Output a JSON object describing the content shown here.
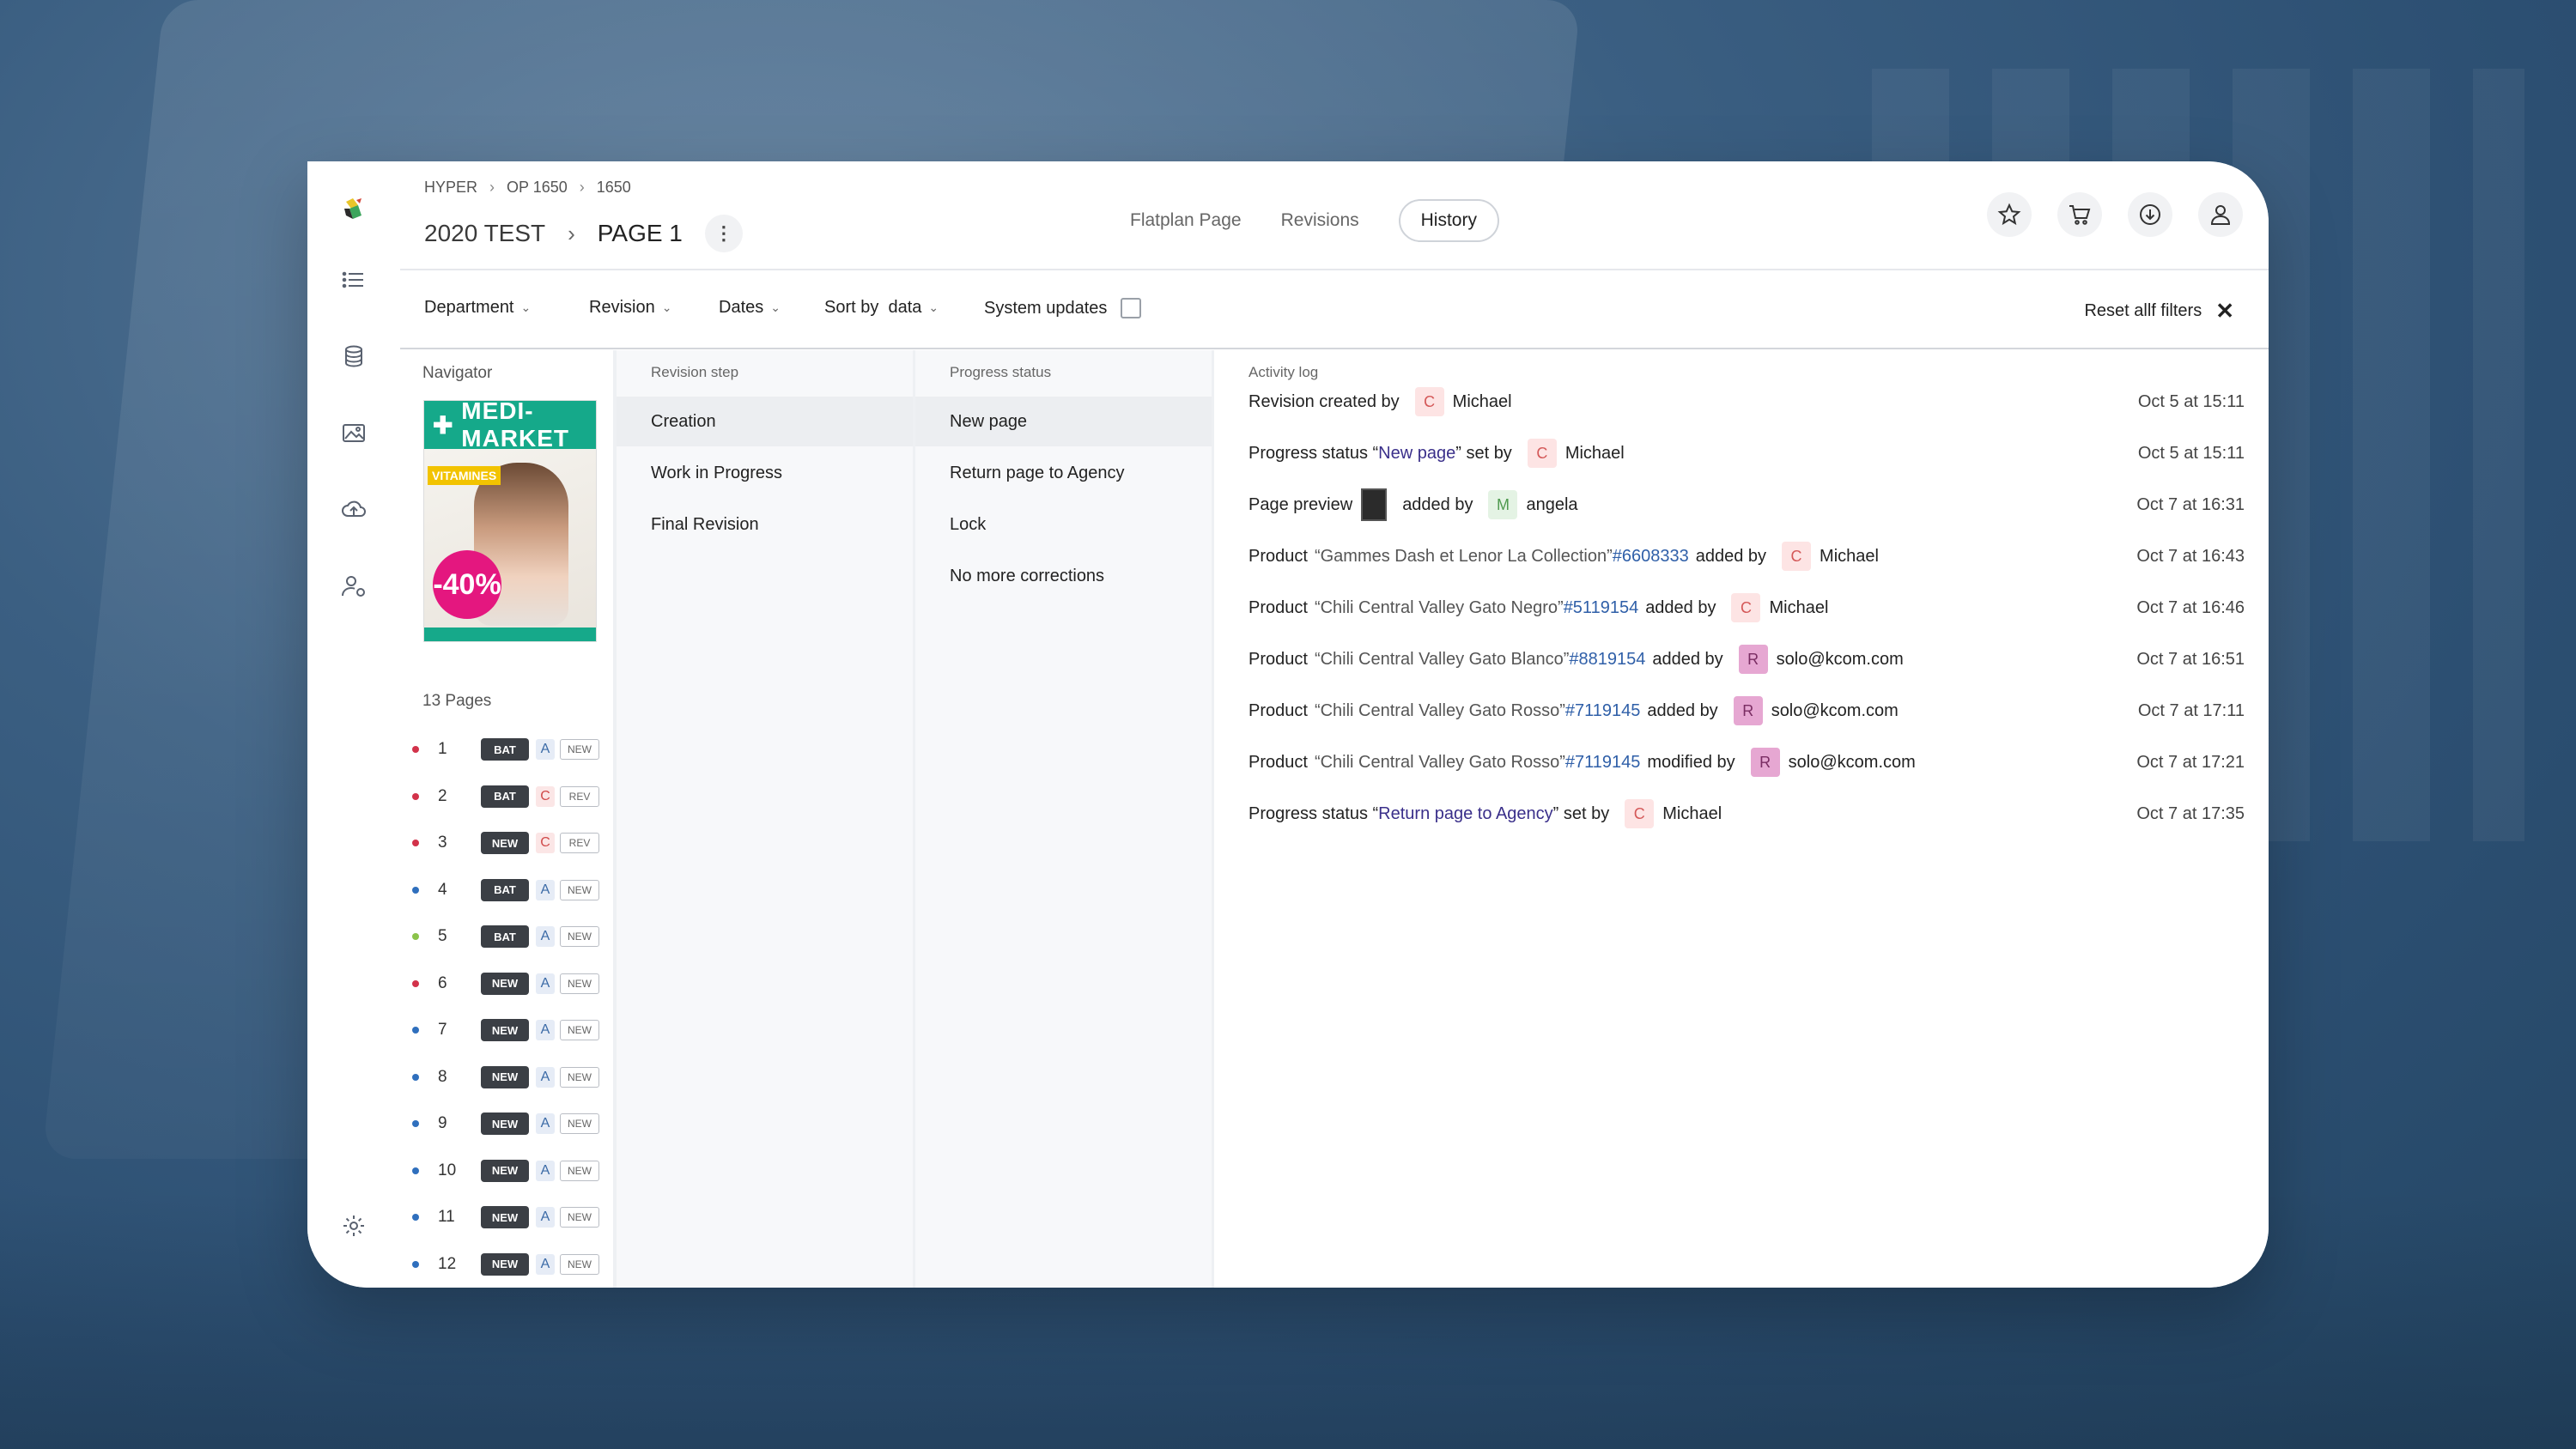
{
  "breadcrumb": [
    "HYPER",
    "OP 1650",
    "1650"
  ],
  "title": {
    "project": "2020 TEST",
    "page": "PAGE 1"
  },
  "tabs": [
    {
      "label": "Flatplan Page",
      "active": false
    },
    {
      "label": "Revisions",
      "active": false
    },
    {
      "label": "History",
      "active": true
    }
  ],
  "header_icons": [
    "star-icon",
    "cart-icon",
    "download-icon",
    "user-icon"
  ],
  "filters": {
    "department": "Department",
    "revision": "Revision",
    "dates": "Dates",
    "sort": "Sort by  data",
    "system_updates": "System updates",
    "reset": "Reset allf filters"
  },
  "navigator": {
    "label": "Navigator",
    "thumbnail": {
      "brand": "MEDI-MARKET",
      "promo": "-40%",
      "tag": "VITAMINES"
    },
    "pages_label": "13 Pages",
    "pages": [
      {
        "num": "1",
        "status": "BAT",
        "letter": "A",
        "tag": "NEW",
        "dot": "#d2324a"
      },
      {
        "num": "2",
        "status": "BAT",
        "letter": "C",
        "tag": "REV",
        "dot": "#d2324a"
      },
      {
        "num": "3",
        "status": "NEW",
        "letter": "C",
        "tag": "REV",
        "dot": "#d2324a"
      },
      {
        "num": "4",
        "status": "BAT",
        "letter": "A",
        "tag": "NEW",
        "dot": "#2f6fbd"
      },
      {
        "num": "5",
        "status": "BAT",
        "letter": "A",
        "tag": "NEW",
        "dot": "#8bc34a"
      },
      {
        "num": "6",
        "status": "NEW",
        "letter": "A",
        "tag": "NEW",
        "dot": "#d2324a"
      },
      {
        "num": "7",
        "status": "NEW",
        "letter": "A",
        "tag": "NEW",
        "dot": "#2f6fbd"
      },
      {
        "num": "8",
        "status": "NEW",
        "letter": "A",
        "tag": "NEW",
        "dot": "#2f6fbd"
      },
      {
        "num": "9",
        "status": "NEW",
        "letter": "A",
        "tag": "NEW",
        "dot": "#2f6fbd"
      },
      {
        "num": "10",
        "status": "NEW",
        "letter": "A",
        "tag": "NEW",
        "dot": "#2f6fbd"
      },
      {
        "num": "11",
        "status": "NEW",
        "letter": "A",
        "tag": "NEW",
        "dot": "#2f6fbd"
      },
      {
        "num": "12",
        "status": "NEW",
        "letter": "A",
        "tag": "NEW",
        "dot": "#2f6fbd"
      }
    ]
  },
  "revision_step": {
    "title": "Revision step",
    "items": [
      "Creation",
      "Work in Progress",
      "Final Revision"
    ],
    "selected": 0
  },
  "progress_status": {
    "title": "Progress status",
    "items": [
      "New page",
      "Return page to Agency",
      "Lock",
      "No more corrections"
    ],
    "selected": 0
  },
  "activity_log": {
    "title": "Activity log",
    "entries": [
      {
        "prefix": "Revision created by",
        "quote": "",
        "link": "",
        "verb": "",
        "avatar": "C",
        "user": "Michael",
        "when": "Oct 5 at 15:11"
      },
      {
        "prefix": "Progress status “",
        "status": "New page",
        "suffix": "” set by",
        "avatar": "C",
        "user": "Michael",
        "when": "Oct 5 at 15:11"
      },
      {
        "prefix": "Page preview",
        "preview": true,
        "verb": "added by",
        "avatar": "M",
        "user": "angela",
        "when": "Oct 7 at 16:31"
      },
      {
        "prefix": "Product",
        "quote": "“Gammes Dash et Lenor La Collection”",
        "link": "#6608333",
        "verb": "added by",
        "avatar": "C",
        "user": "Michael",
        "when": "Oct 7 at 16:43"
      },
      {
        "prefix": "Product",
        "quote": "“Chili Central Valley Gato Negro”",
        "link": "#5119154",
        "verb": "added by",
        "avatar": "C",
        "user": "Michael",
        "when": "Oct 7 at 16:46"
      },
      {
        "prefix": "Product",
        "quote": "“Chili Central Valley Gato Blanco”",
        "link": "#8819154",
        "verb": "added by",
        "avatar": "R",
        "user": "solo@kcom.com",
        "when": "Oct 7 at 16:51"
      },
      {
        "prefix": "Product",
        "quote": "“Chili Central Valley Gato Rosso”",
        "link": "#7119145",
        "verb": "added by",
        "avatar": "R",
        "user": "solo@kcom.com",
        "when": "Oct 7 at 17:11"
      },
      {
        "prefix": "Product",
        "quote": "“Chili Central Valley Gato Rosso”",
        "link": "#7119145",
        "verb": "modified by",
        "avatar": "R",
        "user": "solo@kcom.com",
        "when": "Oct 7 at 17:21"
      },
      {
        "prefix": "Progress status “",
        "status": "Return page to Agency",
        "suffix": "” set by",
        "avatar": "C",
        "user": "Michael",
        "when": "Oct 7 at 17:35"
      }
    ]
  }
}
